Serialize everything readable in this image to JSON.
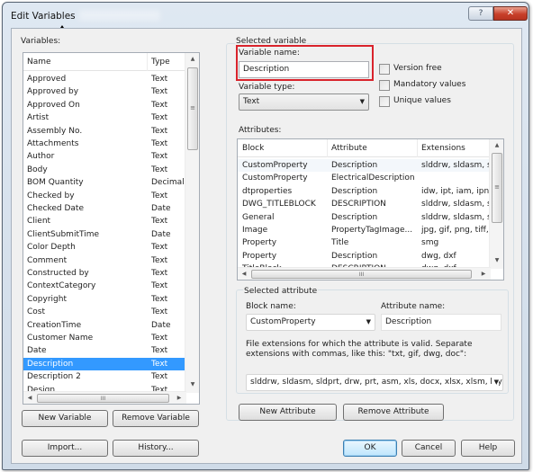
{
  "window": {
    "title": "Edit Variables",
    "help_label": "?",
    "close_label": "✕"
  },
  "variables": {
    "label": "Variables:",
    "columns": {
      "name": "Name",
      "type": "Type"
    },
    "rows": [
      {
        "name": "Approved",
        "type": "Text"
      },
      {
        "name": "Approved by",
        "type": "Text"
      },
      {
        "name": "Approved On",
        "type": "Text"
      },
      {
        "name": "Artist",
        "type": "Text"
      },
      {
        "name": "Assembly No.",
        "type": "Text"
      },
      {
        "name": "Attachments",
        "type": "Text"
      },
      {
        "name": "Author",
        "type": "Text"
      },
      {
        "name": "Body",
        "type": "Text"
      },
      {
        "name": "BOM Quantity",
        "type": "Decimal n."
      },
      {
        "name": "Checked by",
        "type": "Text"
      },
      {
        "name": "Checked Date",
        "type": "Date"
      },
      {
        "name": "Client",
        "type": "Text"
      },
      {
        "name": "ClientSubmitTime",
        "type": "Date"
      },
      {
        "name": "Color Depth",
        "type": "Text"
      },
      {
        "name": "Comment",
        "type": "Text"
      },
      {
        "name": "Constructed by",
        "type": "Text"
      },
      {
        "name": "ContextCategory",
        "type": "Text"
      },
      {
        "name": "Copyright",
        "type": "Text"
      },
      {
        "name": "Cost",
        "type": "Text"
      },
      {
        "name": "CreationTime",
        "type": "Date"
      },
      {
        "name": "Customer Name",
        "type": "Text"
      },
      {
        "name": "Date",
        "type": "Text"
      },
      {
        "name": "Description",
        "type": "Text"
      },
      {
        "name": "Description 2",
        "type": "Text"
      },
      {
        "name": "Design",
        "type": "Text"
      }
    ],
    "selected_index": 22,
    "grip": "≡",
    "hgrip": "III",
    "new_button": "New Variable",
    "remove_button": "Remove Variable",
    "import_button": "Import...",
    "history_button": "History..."
  },
  "selected_variable": {
    "group_label": "Selected variable",
    "name_label": "Variable name:",
    "name_value": "Description",
    "type_label": "Variable type:",
    "type_value": "Text",
    "checkboxes": [
      {
        "label": "Version free",
        "checked": false
      },
      {
        "label": "Mandatory values",
        "checked": false
      },
      {
        "label": "Unique values",
        "checked": false
      }
    ],
    "highlight_color": "#d9232c"
  },
  "attributes": {
    "label": "Attributes:",
    "columns": {
      "block": "Block",
      "attribute": "Attribute",
      "extensions": "Extensions"
    },
    "rows": [
      {
        "block": "CustomProperty",
        "attribute": "Description",
        "extensions": "slddrw, sldasm, sld..."
      },
      {
        "block": "CustomProperty",
        "attribute": "ElectricalDescription",
        "extensions": ""
      },
      {
        "block": "dtproperties",
        "attribute": "Description",
        "extensions": "idw, ipt, iam, ipn, id..."
      },
      {
        "block": "DWG_TITLEBLOCK",
        "attribute": "DESCRIPTION",
        "extensions": "slddrw, sldasm, sld..."
      },
      {
        "block": "General",
        "attribute": "Description",
        "extensions": "slddrw, sldasm, sld..."
      },
      {
        "block": "Image",
        "attribute": "PropertyTagImage...",
        "extensions": "jpg, gif, png, tiff, tif"
      },
      {
        "block": "Property",
        "attribute": "Title",
        "extensions": "smg"
      },
      {
        "block": "Property",
        "attribute": "Description",
        "extensions": "dwg, dxf"
      },
      {
        "block": "TitleBlock",
        "attribute": "DESCRIPTION",
        "extensions": "dwg, dxf"
      }
    ],
    "new_button": "New Attribute",
    "remove_button": "Remove Attribute"
  },
  "selected_attribute": {
    "group_label": "Selected attribute",
    "block_label": "Block name:",
    "block_value": "CustomProperty",
    "attr_label": "Attribute name:",
    "attr_value": "Description",
    "ext_help": "File extensions for which the attribute is valid. Separate extensions with commas, like this: \"txt, gif, dwg, doc\":",
    "ext_value": "slddrw, sldasm, sldprt, drw, prt, asm, xls, docx, xlsx, xlsm, lay, :"
  },
  "footer": {
    "ok": "OK",
    "cancel": "Cancel",
    "help": "Help"
  },
  "glyphs": {
    "up": "▲",
    "down": "▼",
    "left": "◀",
    "right": "▶",
    "dropdown": "▼"
  }
}
